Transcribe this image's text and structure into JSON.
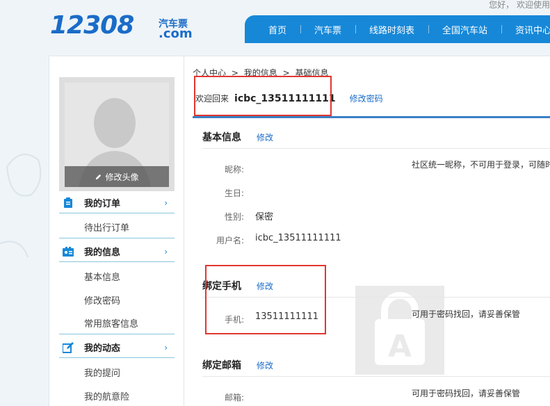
{
  "header": {
    "logo_number": "12308",
    "logo_cn": "汽车票",
    "logo_domain": ".com",
    "greeting": "您好， 欢迎使用",
    "nav": [
      "首页",
      "汽车票",
      "线路时刻表",
      "全国汽车站",
      "资讯中心"
    ]
  },
  "sidebar": {
    "avatar_edit": "修改头像",
    "groups": [
      {
        "icon": "order-icon",
        "title": "我的订单",
        "items": [
          "待出行订单"
        ]
      },
      {
        "icon": "id-card-icon",
        "title": "我的信息",
        "items": [
          "基本信息",
          "修改密码",
          "常用旅客信息"
        ]
      },
      {
        "icon": "edit-icon",
        "title": "我的动态",
        "items": [
          "我的提问",
          "我的航意险"
        ]
      }
    ]
  },
  "breadcrumb": [
    "个人中心",
    ">",
    "我的信息",
    ">",
    "基础信息"
  ],
  "welcome": {
    "label": "欢迎回来",
    "username": "icbc_13511111111",
    "change_password": "修改密码"
  },
  "basic": {
    "title": "基本信息",
    "edit": "修改",
    "nickname_label": "昵称:",
    "nickname_note": "社区统一昵称，不可用于登录，可随时",
    "birthday_label": "生日:",
    "gender_label": "性别:",
    "gender_value": "保密",
    "username_label": "用户名:",
    "username_value": "icbc_13511111111"
  },
  "phone": {
    "title": "绑定手机",
    "edit": "修改",
    "label": "手机:",
    "value": "13511111111",
    "note": "可用于密码找回，请妥善保管"
  },
  "email": {
    "title": "绑定邮箱",
    "edit": "修改",
    "label": "邮箱:",
    "note": "可用于密码找回，请妥善保管"
  },
  "colors": {
    "brand": "#1788d8",
    "highlight": "#e2352f",
    "link": "#1a6cc8"
  }
}
